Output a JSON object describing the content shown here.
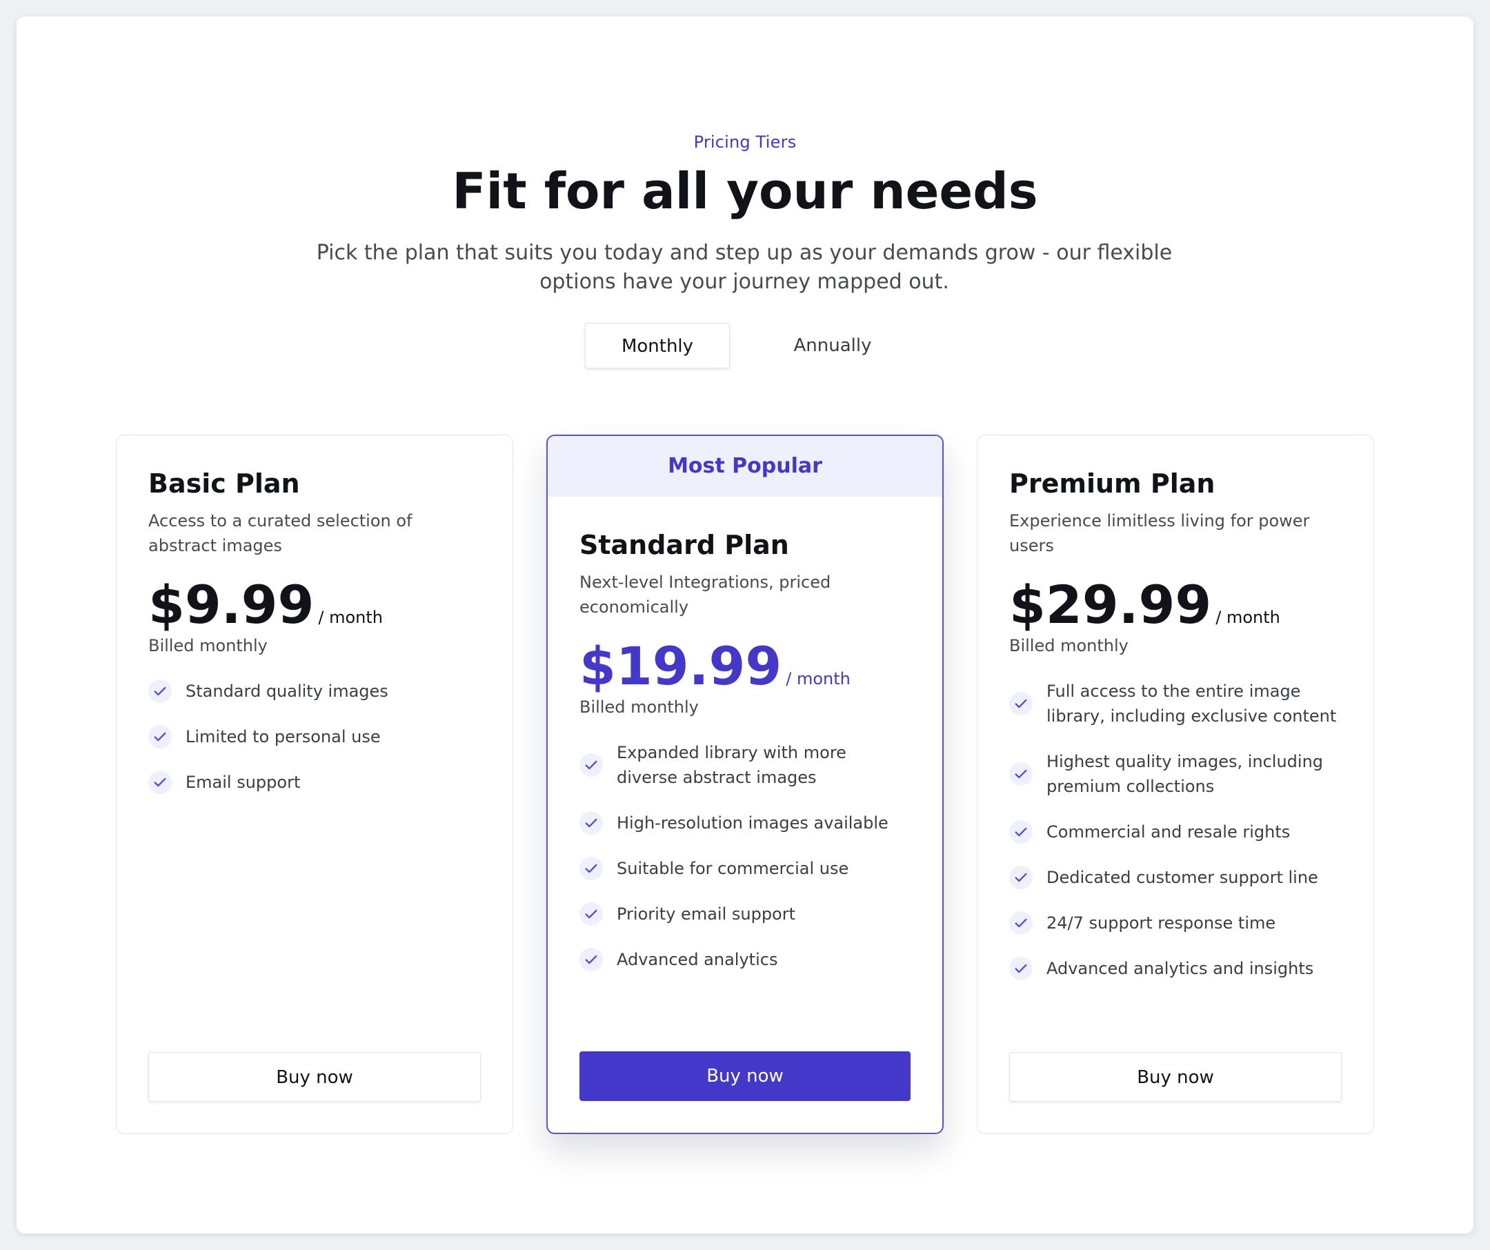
{
  "header": {
    "eyebrow": "Pricing Tiers",
    "title": "Fit for all your needs",
    "subtitle": "Pick the plan that suits you today and step up as your demands grow - our flexible options have your journey mapped out."
  },
  "billing_toggle": {
    "options": [
      "Monthly",
      "Annually"
    ],
    "selected": "Monthly"
  },
  "plans": [
    {
      "name": "Basic Plan",
      "description": "Access to a curated selection of abstract images",
      "price": "$9.99",
      "per": "/ month",
      "billing": "Billed monthly",
      "features": [
        "Standard quality images",
        "Limited to personal use",
        "Email support"
      ],
      "cta": "Buy now"
    },
    {
      "badge": "Most Popular",
      "name": "Standard Plan",
      "description": "Next-level Integrations, priced economically",
      "price": "$19.99",
      "per": "/ month",
      "billing": "Billed monthly",
      "features": [
        "Expanded library with more diverse abstract images",
        "High-resolution images available",
        "Suitable for commercial use",
        "Priority email support",
        "Advanced analytics"
      ],
      "cta": "Buy now"
    },
    {
      "name": "Premium Plan",
      "description": "Experience limitless living for power users",
      "price": "$29.99",
      "per": "/ month",
      "billing": "Billed monthly",
      "features": [
        "Full access to the entire image library, including exclusive content",
        "Highest quality images, including premium collections",
        "Commercial and resale rights",
        "Dedicated customer support line",
        "24/7 support response time",
        "Advanced analytics and insights"
      ],
      "cta": "Buy now"
    }
  ],
  "icons": {
    "feature_check": "check-icon"
  },
  "colors": {
    "accent": "#4338ca",
    "popular_banner_bg": "#eef0fd",
    "check_circle_bg": "#eef0fb",
    "page_bg": "#eef0f3",
    "text_primary": "#111318",
    "text_secondary": "#474a55"
  }
}
